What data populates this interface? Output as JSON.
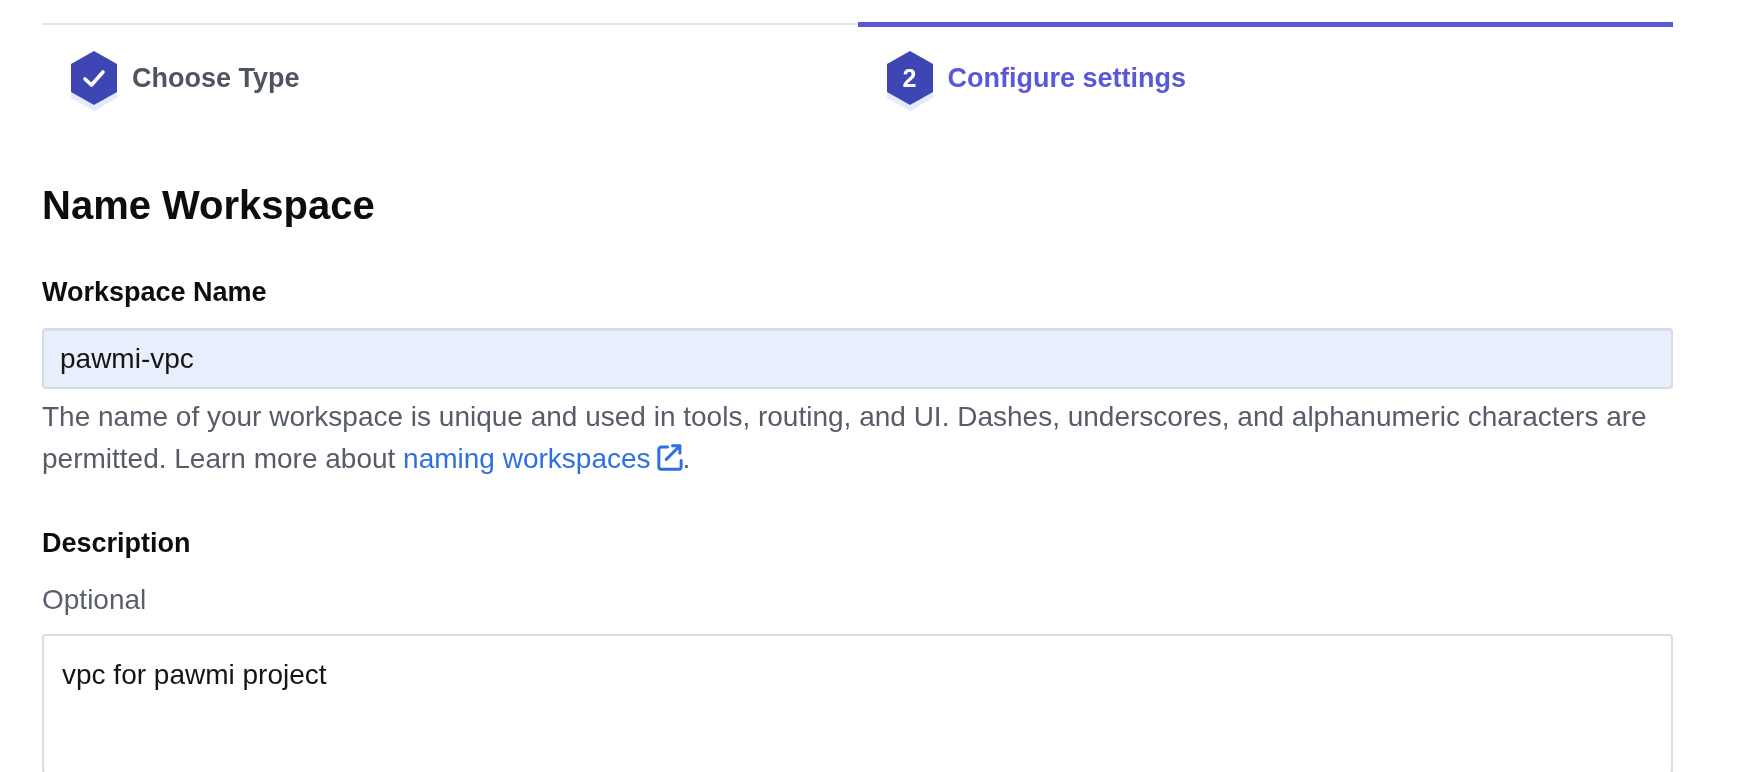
{
  "stepper": {
    "steps": [
      {
        "label": "Choose Type",
        "completed": true,
        "selected": false
      },
      {
        "label": "Configure settings",
        "number": "2",
        "completed": false,
        "selected": true
      }
    ]
  },
  "form": {
    "title": "Name Workspace",
    "fields": [
      {
        "kind": "input",
        "label": "Workspace Name",
        "value": "pawmi-vpc",
        "help": {
          "text": "The name of your workspace is unique and used in tools, routing, and UI. Dashes, underscores, and alphanumeric characters are permitted. Learn more about ",
          "link": "naming workspaces",
          "after": "."
        }
      },
      {
        "kind": "textarea",
        "label": "Description",
        "hint": "Optional",
        "value": "vpc for pawmi project"
      }
    ]
  }
}
